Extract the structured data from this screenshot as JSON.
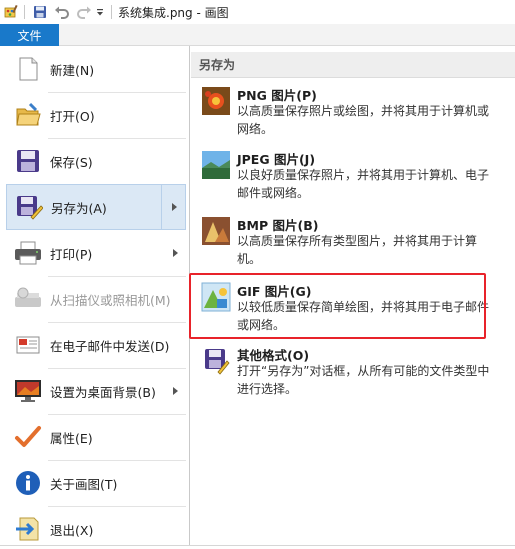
{
  "window": {
    "title": "系统集成.png - 画图"
  },
  "quick_access": {
    "icons": [
      "paint-app-icon",
      "save-icon",
      "undo-icon",
      "redo-icon",
      "customize-dropdown-icon"
    ]
  },
  "ribbon": {
    "file_tab": "文件"
  },
  "left_menu": {
    "items": [
      {
        "label": "新建(N)",
        "icon": "new-document-icon",
        "submenu": false,
        "enabled": true
      },
      {
        "label": "打开(O)",
        "icon": "open-folder-icon",
        "submenu": false,
        "enabled": true
      },
      {
        "label": "保存(S)",
        "icon": "save-icon",
        "submenu": false,
        "enabled": true
      },
      {
        "label": "另存为(A)",
        "icon": "save-as-icon",
        "submenu": true,
        "enabled": true,
        "selected": true
      },
      {
        "label": "打印(P)",
        "icon": "printer-icon",
        "submenu": true,
        "enabled": true
      },
      {
        "label": "从扫描仪或照相机(M)",
        "icon": "scanner-icon",
        "submenu": false,
        "enabled": false
      },
      {
        "label": "在电子邮件中发送(D)",
        "icon": "email-icon",
        "submenu": false,
        "enabled": true
      },
      {
        "label": "设置为桌面背景(B)",
        "icon": "desktop-background-icon",
        "submenu": true,
        "enabled": true
      },
      {
        "label": "属性(E)",
        "icon": "checkmark-icon",
        "submenu": false,
        "enabled": true
      },
      {
        "label": "关于画图(T)",
        "icon": "info-icon",
        "submenu": false,
        "enabled": true
      },
      {
        "label": "退出(X)",
        "icon": "exit-icon",
        "submenu": false,
        "enabled": true
      }
    ]
  },
  "save_as_pane": {
    "header": "另存为",
    "formats": [
      {
        "title": "PNG 图片(P)",
        "description": "以高质量保存照片或绘图，并将其用于计算机或网络。",
        "icon": "png-image-icon"
      },
      {
        "title": "JPEG 图片(J)",
        "description": "以良好质量保存照片，并将其用于计算机、电子邮件或网络。",
        "icon": "jpeg-image-icon"
      },
      {
        "title": "BMP 图片(B)",
        "description": "以高质量保存所有类型图片，并将其用于计算机。",
        "icon": "bmp-image-icon"
      },
      {
        "title": "GIF 图片(G)",
        "description": "以较低质量保存简单绘图，并将其用于电子邮件或网络。",
        "icon": "gif-image-icon",
        "highlighted": true
      },
      {
        "title": "其他格式(O)",
        "description": "打开“另存为”对话框，从所有可能的文件类型中进行选择。",
        "icon": "other-formats-icon"
      }
    ]
  },
  "colors": {
    "file_tab_bg": "#1979ca",
    "selected_item_bg": "#dbe8f5",
    "highlight_border": "#e8232a"
  }
}
